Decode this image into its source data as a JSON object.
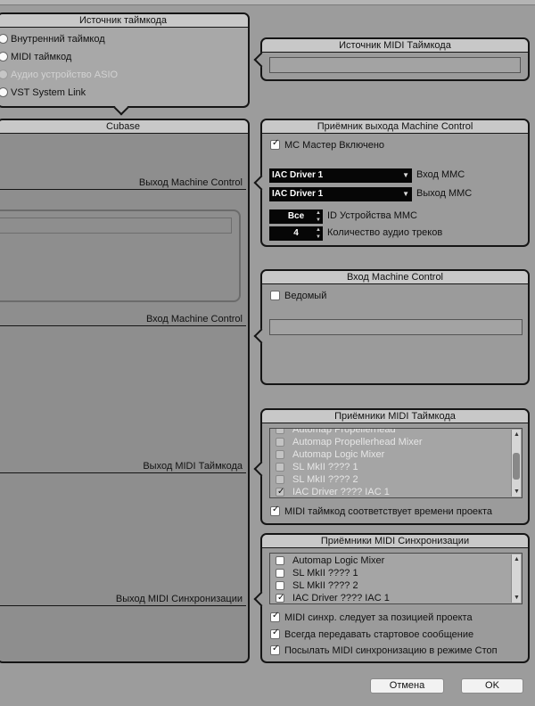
{
  "timecode_source": {
    "title": "Источник таймкода",
    "options": [
      {
        "label": "Внутренний таймкод",
        "disabled": false
      },
      {
        "label": "MIDI таймкод",
        "disabled": false
      },
      {
        "label": "Аудио устройство ASIO",
        "disabled": true
      },
      {
        "label": "VST System Link",
        "disabled": false
      }
    ]
  },
  "midi_timecode_source": {
    "title": "Источник MIDI Таймкода",
    "value": ""
  },
  "cubase": {
    "title": "Cubase",
    "connections": {
      "mc_out": "Выход Machine Control",
      "mc_in": "Вход Machine Control",
      "midi_tc_out": "Выход MIDI Таймкода",
      "midi_sync_out": "Выход MIDI Синхронизации"
    }
  },
  "mc_output_receiver": {
    "title": "Приёмник выхода Machine Control",
    "master_enabled_label": "MC Мастер Включено",
    "master_enabled": true,
    "mmc_in_select": "IAC Driver 1",
    "mmc_in_label": "Вход MMC",
    "mmc_out_select": "IAC Driver 1",
    "mmc_out_label": "Выход MMC",
    "device_id_value": "Все",
    "device_id_label": "ID Устройства MMC",
    "audio_tracks_value": "4",
    "audio_tracks_label": "Количество аудио треков"
  },
  "mc_input": {
    "title": "Вход Machine Control",
    "slave_label": "Ведомый",
    "slave": false,
    "field_value": ""
  },
  "midi_tc_receivers": {
    "title": "Приёмники MIDI Таймкода",
    "items": [
      {
        "label": "Automap Propellerhead",
        "checked": false,
        "dim": true
      },
      {
        "label": "Automap Propellerhead Mixer",
        "checked": false,
        "dim": true
      },
      {
        "label": "Automap Logic Mixer",
        "checked": false,
        "dim": true
      },
      {
        "label": "SL MkII ???? 1",
        "checked": false,
        "dim": true
      },
      {
        "label": "SL MkII ???? 2",
        "checked": false,
        "dim": true
      },
      {
        "label": "IAC Driver ???? IAC 1",
        "checked": true,
        "dim": true
      }
    ],
    "option_label": "MIDI таймкод соответствует времени проекта",
    "option_checked": true
  },
  "midi_sync_receivers": {
    "title": "Приёмники MIDI Синхронизации",
    "items": [
      {
        "label": "Automap Logic Mixer",
        "checked": false,
        "dim": false
      },
      {
        "label": "SL MkII ???? 1",
        "checked": false,
        "dim": false
      },
      {
        "label": "SL MkII ???? 2",
        "checked": false,
        "dim": false
      },
      {
        "label": "IAC Driver ???? IAC 1",
        "checked": true,
        "dim": false
      }
    ],
    "options": [
      {
        "label": "MIDI синхр. следует за позицией проекта",
        "checked": true
      },
      {
        "label": "Всегда передавать стартовое сообщение",
        "checked": true
      },
      {
        "label": "Посылать MIDI синхронизацию в режиме Стоп",
        "checked": true
      }
    ]
  },
  "buttons": {
    "cancel": "Отмена",
    "ok": "OK"
  }
}
